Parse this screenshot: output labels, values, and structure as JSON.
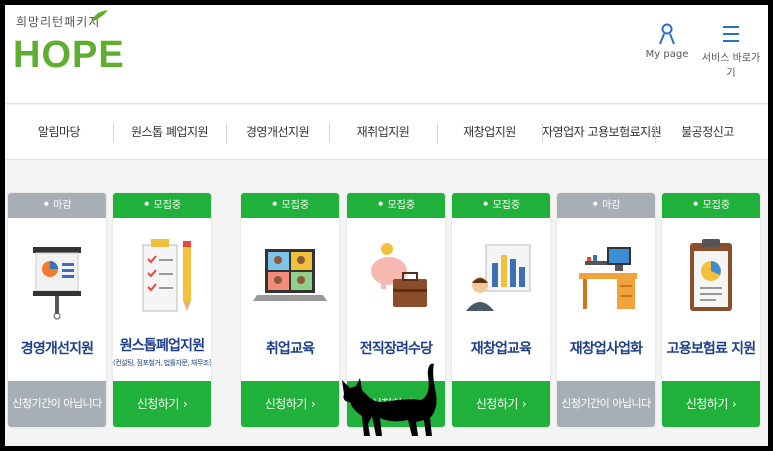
{
  "header": {
    "logo_small": "희망리턴패키지",
    "logo_big": "HOPE",
    "mypage_label": "My page",
    "services_label": "서비스 바로가기",
    "brand_green": "#5fae2e"
  },
  "nav": {
    "items": [
      "알림마당",
      "원스톱 폐업지원",
      "경영개선지원",
      "재취업지원",
      "재창업지원",
      "자영업자 고용보험료지원",
      "불공정신고"
    ]
  },
  "cards": [
    {
      "badge": "마감",
      "status": "closed",
      "title": "경영개선지원",
      "note": "",
      "action": "신청기간이 아닙니다",
      "illustration": "presentation-chart-icon"
    },
    {
      "badge": "모집중",
      "status": "open",
      "title": "원스톱폐업지원",
      "note": "(컨설팅, 점포철거, 법률자문, 채무조정)",
      "action": "신청하기",
      "illustration": "checklist-pencil-icon"
    },
    {
      "badge": "모집중",
      "status": "open",
      "title": "취업교육",
      "note": "",
      "action": "신청하기",
      "illustration": "video-call-laptop-icon"
    },
    {
      "badge": "모집중",
      "status": "open",
      "title": "전직장려수당",
      "note": "",
      "action": "신청하기",
      "illustration": "piggybank-briefcase-icon"
    },
    {
      "badge": "모집중",
      "status": "open",
      "title": "재창업교육",
      "note": "",
      "action": "신청하기",
      "illustration": "presenter-board-icon"
    },
    {
      "badge": "마감",
      "status": "closed",
      "title": "재창업사업화",
      "note": "",
      "action": "신청기간이 아닙니다",
      "illustration": "office-desk-icon"
    },
    {
      "badge": "모집중",
      "status": "open",
      "title": "고용보험료 지원",
      "note": "",
      "action": "신청하기",
      "illustration": "clipboard-pie-icon"
    }
  ],
  "colors": {
    "open_green": "#1fb13a",
    "closed_gray": "#a8aeb6",
    "title_navy": "#1d3f8a"
  }
}
